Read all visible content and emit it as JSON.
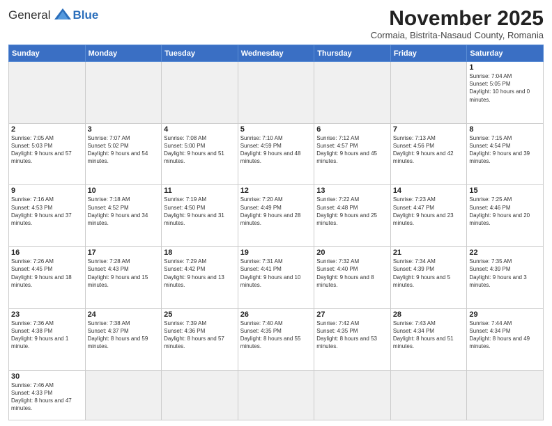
{
  "header": {
    "logo_general": "General",
    "logo_blue": "Blue",
    "month_title": "November 2025",
    "subtitle": "Cormaia, Bistrita-Nasaud County, Romania"
  },
  "weekdays": [
    "Sunday",
    "Monday",
    "Tuesday",
    "Wednesday",
    "Thursday",
    "Friday",
    "Saturday"
  ],
  "days": [
    {
      "date": "",
      "info": ""
    },
    {
      "date": "",
      "info": ""
    },
    {
      "date": "",
      "info": ""
    },
    {
      "date": "",
      "info": ""
    },
    {
      "date": "",
      "info": ""
    },
    {
      "date": "",
      "info": ""
    },
    {
      "date": "1",
      "info": "Sunrise: 7:04 AM\nSunset: 5:05 PM\nDaylight: 10 hours and 0 minutes."
    },
    {
      "date": "2",
      "info": "Sunrise: 7:05 AM\nSunset: 5:03 PM\nDaylight: 9 hours and 57 minutes."
    },
    {
      "date": "3",
      "info": "Sunrise: 7:07 AM\nSunset: 5:02 PM\nDaylight: 9 hours and 54 minutes."
    },
    {
      "date": "4",
      "info": "Sunrise: 7:08 AM\nSunset: 5:00 PM\nDaylight: 9 hours and 51 minutes."
    },
    {
      "date": "5",
      "info": "Sunrise: 7:10 AM\nSunset: 4:59 PM\nDaylight: 9 hours and 48 minutes."
    },
    {
      "date": "6",
      "info": "Sunrise: 7:12 AM\nSunset: 4:57 PM\nDaylight: 9 hours and 45 minutes."
    },
    {
      "date": "7",
      "info": "Sunrise: 7:13 AM\nSunset: 4:56 PM\nDaylight: 9 hours and 42 minutes."
    },
    {
      "date": "8",
      "info": "Sunrise: 7:15 AM\nSunset: 4:54 PM\nDaylight: 9 hours and 39 minutes."
    },
    {
      "date": "9",
      "info": "Sunrise: 7:16 AM\nSunset: 4:53 PM\nDaylight: 9 hours and 37 minutes."
    },
    {
      "date": "10",
      "info": "Sunrise: 7:18 AM\nSunset: 4:52 PM\nDaylight: 9 hours and 34 minutes."
    },
    {
      "date": "11",
      "info": "Sunrise: 7:19 AM\nSunset: 4:50 PM\nDaylight: 9 hours and 31 minutes."
    },
    {
      "date": "12",
      "info": "Sunrise: 7:20 AM\nSunset: 4:49 PM\nDaylight: 9 hours and 28 minutes."
    },
    {
      "date": "13",
      "info": "Sunrise: 7:22 AM\nSunset: 4:48 PM\nDaylight: 9 hours and 25 minutes."
    },
    {
      "date": "14",
      "info": "Sunrise: 7:23 AM\nSunset: 4:47 PM\nDaylight: 9 hours and 23 minutes."
    },
    {
      "date": "15",
      "info": "Sunrise: 7:25 AM\nSunset: 4:46 PM\nDaylight: 9 hours and 20 minutes."
    },
    {
      "date": "16",
      "info": "Sunrise: 7:26 AM\nSunset: 4:45 PM\nDaylight: 9 hours and 18 minutes."
    },
    {
      "date": "17",
      "info": "Sunrise: 7:28 AM\nSunset: 4:43 PM\nDaylight: 9 hours and 15 minutes."
    },
    {
      "date": "18",
      "info": "Sunrise: 7:29 AM\nSunset: 4:42 PM\nDaylight: 9 hours and 13 minutes."
    },
    {
      "date": "19",
      "info": "Sunrise: 7:31 AM\nSunset: 4:41 PM\nDaylight: 9 hours and 10 minutes."
    },
    {
      "date": "20",
      "info": "Sunrise: 7:32 AM\nSunset: 4:40 PM\nDaylight: 9 hours and 8 minutes."
    },
    {
      "date": "21",
      "info": "Sunrise: 7:34 AM\nSunset: 4:39 PM\nDaylight: 9 hours and 5 minutes."
    },
    {
      "date": "22",
      "info": "Sunrise: 7:35 AM\nSunset: 4:39 PM\nDaylight: 9 hours and 3 minutes."
    },
    {
      "date": "23",
      "info": "Sunrise: 7:36 AM\nSunset: 4:38 PM\nDaylight: 9 hours and 1 minute."
    },
    {
      "date": "24",
      "info": "Sunrise: 7:38 AM\nSunset: 4:37 PM\nDaylight: 8 hours and 59 minutes."
    },
    {
      "date": "25",
      "info": "Sunrise: 7:39 AM\nSunset: 4:36 PM\nDaylight: 8 hours and 57 minutes."
    },
    {
      "date": "26",
      "info": "Sunrise: 7:40 AM\nSunset: 4:35 PM\nDaylight: 8 hours and 55 minutes."
    },
    {
      "date": "27",
      "info": "Sunrise: 7:42 AM\nSunset: 4:35 PM\nDaylight: 8 hours and 53 minutes."
    },
    {
      "date": "28",
      "info": "Sunrise: 7:43 AM\nSunset: 4:34 PM\nDaylight: 8 hours and 51 minutes."
    },
    {
      "date": "29",
      "info": "Sunrise: 7:44 AM\nSunset: 4:34 PM\nDaylight: 8 hours and 49 minutes."
    },
    {
      "date": "30",
      "info": "Sunrise: 7:46 AM\nSunset: 4:33 PM\nDaylight: 8 hours and 47 minutes."
    }
  ]
}
